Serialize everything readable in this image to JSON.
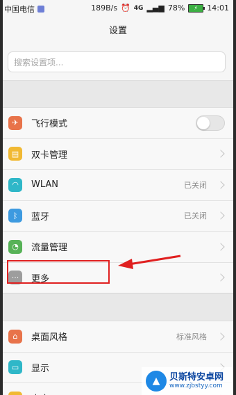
{
  "statusbar": {
    "carrier": "中国电信",
    "speed": "189B/s",
    "network": "4G",
    "battery_percent": "78%",
    "time": "14:01"
  },
  "header": {
    "title": "设置"
  },
  "search": {
    "placeholder": "搜索设置项..."
  },
  "group1": [
    {
      "label": "飞行模式",
      "icon": "airplane-icon",
      "color": "#e8734a",
      "control": "toggle",
      "toggle_on": false
    },
    {
      "label": "双卡管理",
      "icon": "sim-card-icon",
      "color": "#f1b933",
      "control": "chevron"
    },
    {
      "label": "WLAN",
      "icon": "wifi-icon",
      "color": "#2fb7c8",
      "value": "已关闭",
      "control": "chevron"
    },
    {
      "label": "蓝牙",
      "icon": "bluetooth-icon",
      "color": "#3d9ae0",
      "value": "已关闭",
      "control": "chevron"
    },
    {
      "label": "流量管理",
      "icon": "data-usage-icon",
      "color": "#57b257",
      "control": "chevron"
    },
    {
      "label": "更多",
      "icon": "more-icon",
      "color": "#9d9d9d",
      "control": "chevron"
    }
  ],
  "group2": [
    {
      "label": "桌面风格",
      "icon": "home-icon",
      "color": "#e8734a",
      "value": "标准风格",
      "control": "chevron"
    },
    {
      "label": "显示",
      "icon": "display-icon",
      "color": "#2fb7c8",
      "control": "chevron"
    },
    {
      "label": "声音",
      "icon": "sound-icon",
      "color": "#f1b933",
      "control": "chevron"
    }
  ],
  "annotation": {
    "color": "#e02020"
  },
  "watermark": {
    "title": "贝斯特安卓网",
    "url": "www.zjbstyy.com"
  }
}
